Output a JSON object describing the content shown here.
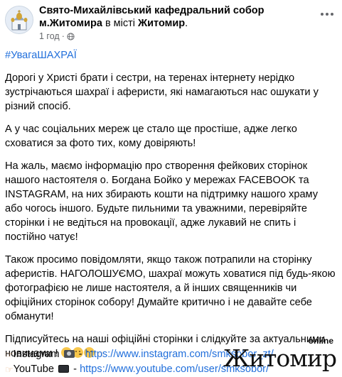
{
  "post": {
    "page_name": "Свято-Михайлівський кафедральний собор м.Житомира",
    "connector": " в місті ",
    "location": "Житомир",
    "location_tail": ".",
    "time": "1 год",
    "time_sep": " · ",
    "hashtag": "#УвагаШАХРАЇ",
    "paragraphs": [
      "Дорогі у Христі брати і сестри, на теренах інтернету нерідко зустрічаються шахраї і аферисти, які намагаються нас ошукати у різний спосіб.",
      "А у час соціальних мереж це стало ще простіше, адже легко сховатися за фото тих, кому довіряють!",
      "На жаль, маємо інформацію про створення фейкових сторінок нашого настоятеля о. Богдана Бойко у мережах FACEBOOK та INSTAGRAM, на них збирають кошти на підтримку нашого храму або чогось іншого. Будьте пильними та уважними, перевіряйте сторінки і не ведіться на провокації, адже лукавий не спить і постійно чатує!",
      "Також просимо повідомляти, якщо також потрапили на сторінку аферистів. НАГОЛОШУЄМО, шахраї можуть ховатися під будь-якою фотографією не лише настоятеля, а й інших священників чи офіційних сторінок собору! Думайте критично і не давайте себе обманути!",
      "Підписуйтесь на наші офіційні сторінки і слідкуйте за актуальними новинами ! "
    ],
    "links": [
      {
        "label": "Instagram",
        "sep": " - ",
        "url": "https://www.instagram.com/smksobor_zt/"
      },
      {
        "label": "YouTube",
        "sep": " - ",
        "url": "https://www.youtube.com/user/smksobor/"
      }
    ]
  },
  "watermark": {
    "top": "online",
    "main": "Житомир"
  },
  "icons": {
    "avatar": "cathedral-logo-icon",
    "privacy": "globe-icon",
    "more": "more-options-icon",
    "emoji_1": "smiling-face-icon",
    "emoji_2": "smiling-face-icon",
    "emoji_3": "smiling-face-icon",
    "pointing": "backhand-index-pointing-left-icon",
    "camera": "camera-icon",
    "tv": "television-icon"
  },
  "colors": {
    "link": "#216fdb",
    "meta": "#65676b",
    "text": "#050505"
  }
}
